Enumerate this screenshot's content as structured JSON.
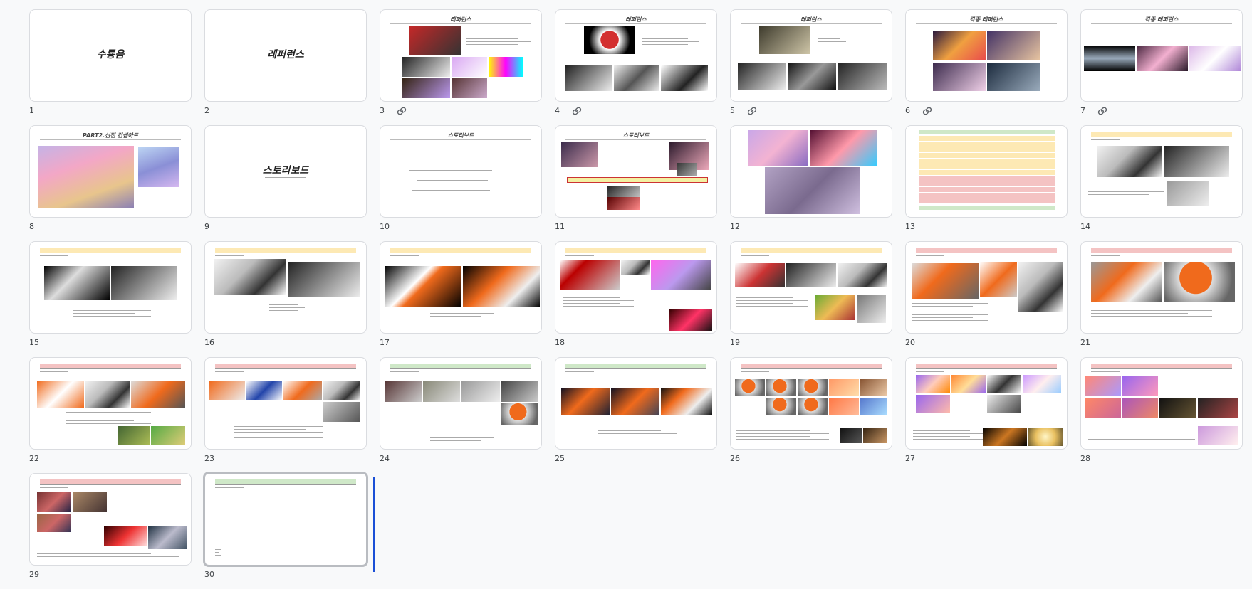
{
  "slides": [
    {
      "number": "1",
      "title": "수룡음",
      "layout": "center"
    },
    {
      "number": "2",
      "title": "레퍼런스",
      "layout": "center"
    },
    {
      "number": "3",
      "title": "레퍼런스",
      "layout": "ref-a",
      "linked": true
    },
    {
      "number": "4",
      "title": "레퍼런스",
      "layout": "ref-b",
      "linked": true
    },
    {
      "number": "5",
      "title": "레퍼런스",
      "layout": "ref-c",
      "linked": true
    },
    {
      "number": "6",
      "title": "각종 레퍼런스",
      "layout": "ref-d",
      "linked": true
    },
    {
      "number": "7",
      "title": "각종 레퍼런스",
      "layout": "ref-e",
      "linked": true
    },
    {
      "number": "8",
      "title": "PART2.신전 컨셉아트",
      "layout": "concept"
    },
    {
      "number": "9",
      "title": "스토리보드",
      "layout": "center"
    },
    {
      "number": "10",
      "title": "스토리보드",
      "layout": "text"
    },
    {
      "number": "11",
      "title": "스토리보드",
      "layout": "timeline"
    },
    {
      "number": "12",
      "title": "",
      "layout": "collage"
    },
    {
      "number": "13",
      "title": "",
      "layout": "table"
    },
    {
      "number": "14",
      "title": "",
      "layout": "sb-yellow"
    },
    {
      "number": "15",
      "title": "",
      "layout": "sb-yellow"
    },
    {
      "number": "16",
      "title": "",
      "layout": "sb-yellow"
    },
    {
      "number": "17",
      "title": "",
      "layout": "sb-yellow"
    },
    {
      "number": "18",
      "title": "",
      "layout": "sb-yellow"
    },
    {
      "number": "19",
      "title": "",
      "layout": "sb-yellow"
    },
    {
      "number": "20",
      "title": "",
      "layout": "sb-red"
    },
    {
      "number": "21",
      "title": "",
      "layout": "sb-red"
    },
    {
      "number": "22",
      "title": "",
      "layout": "sb-red"
    },
    {
      "number": "23",
      "title": "",
      "layout": "sb-red"
    },
    {
      "number": "24",
      "title": "",
      "layout": "sb-green"
    },
    {
      "number": "25",
      "title": "",
      "layout": "sb-green"
    },
    {
      "number": "26",
      "title": "",
      "layout": "sb-red"
    },
    {
      "number": "27",
      "title": "",
      "layout": "sb-red"
    },
    {
      "number": "28",
      "title": "",
      "layout": "sb-red"
    },
    {
      "number": "29",
      "title": "",
      "layout": "sb-red"
    },
    {
      "number": "30",
      "title": "",
      "layout": "blank-green",
      "selected": true
    }
  ],
  "colors": {
    "accent_drag_indicator": "#1a4fd6",
    "header_yellow": "#fde9b4",
    "header_red": "#f4c3c3",
    "header_green": "#cfe8c8",
    "maple_orange": "#f06a1c"
  },
  "icons": {
    "linked": "link-icon"
  }
}
